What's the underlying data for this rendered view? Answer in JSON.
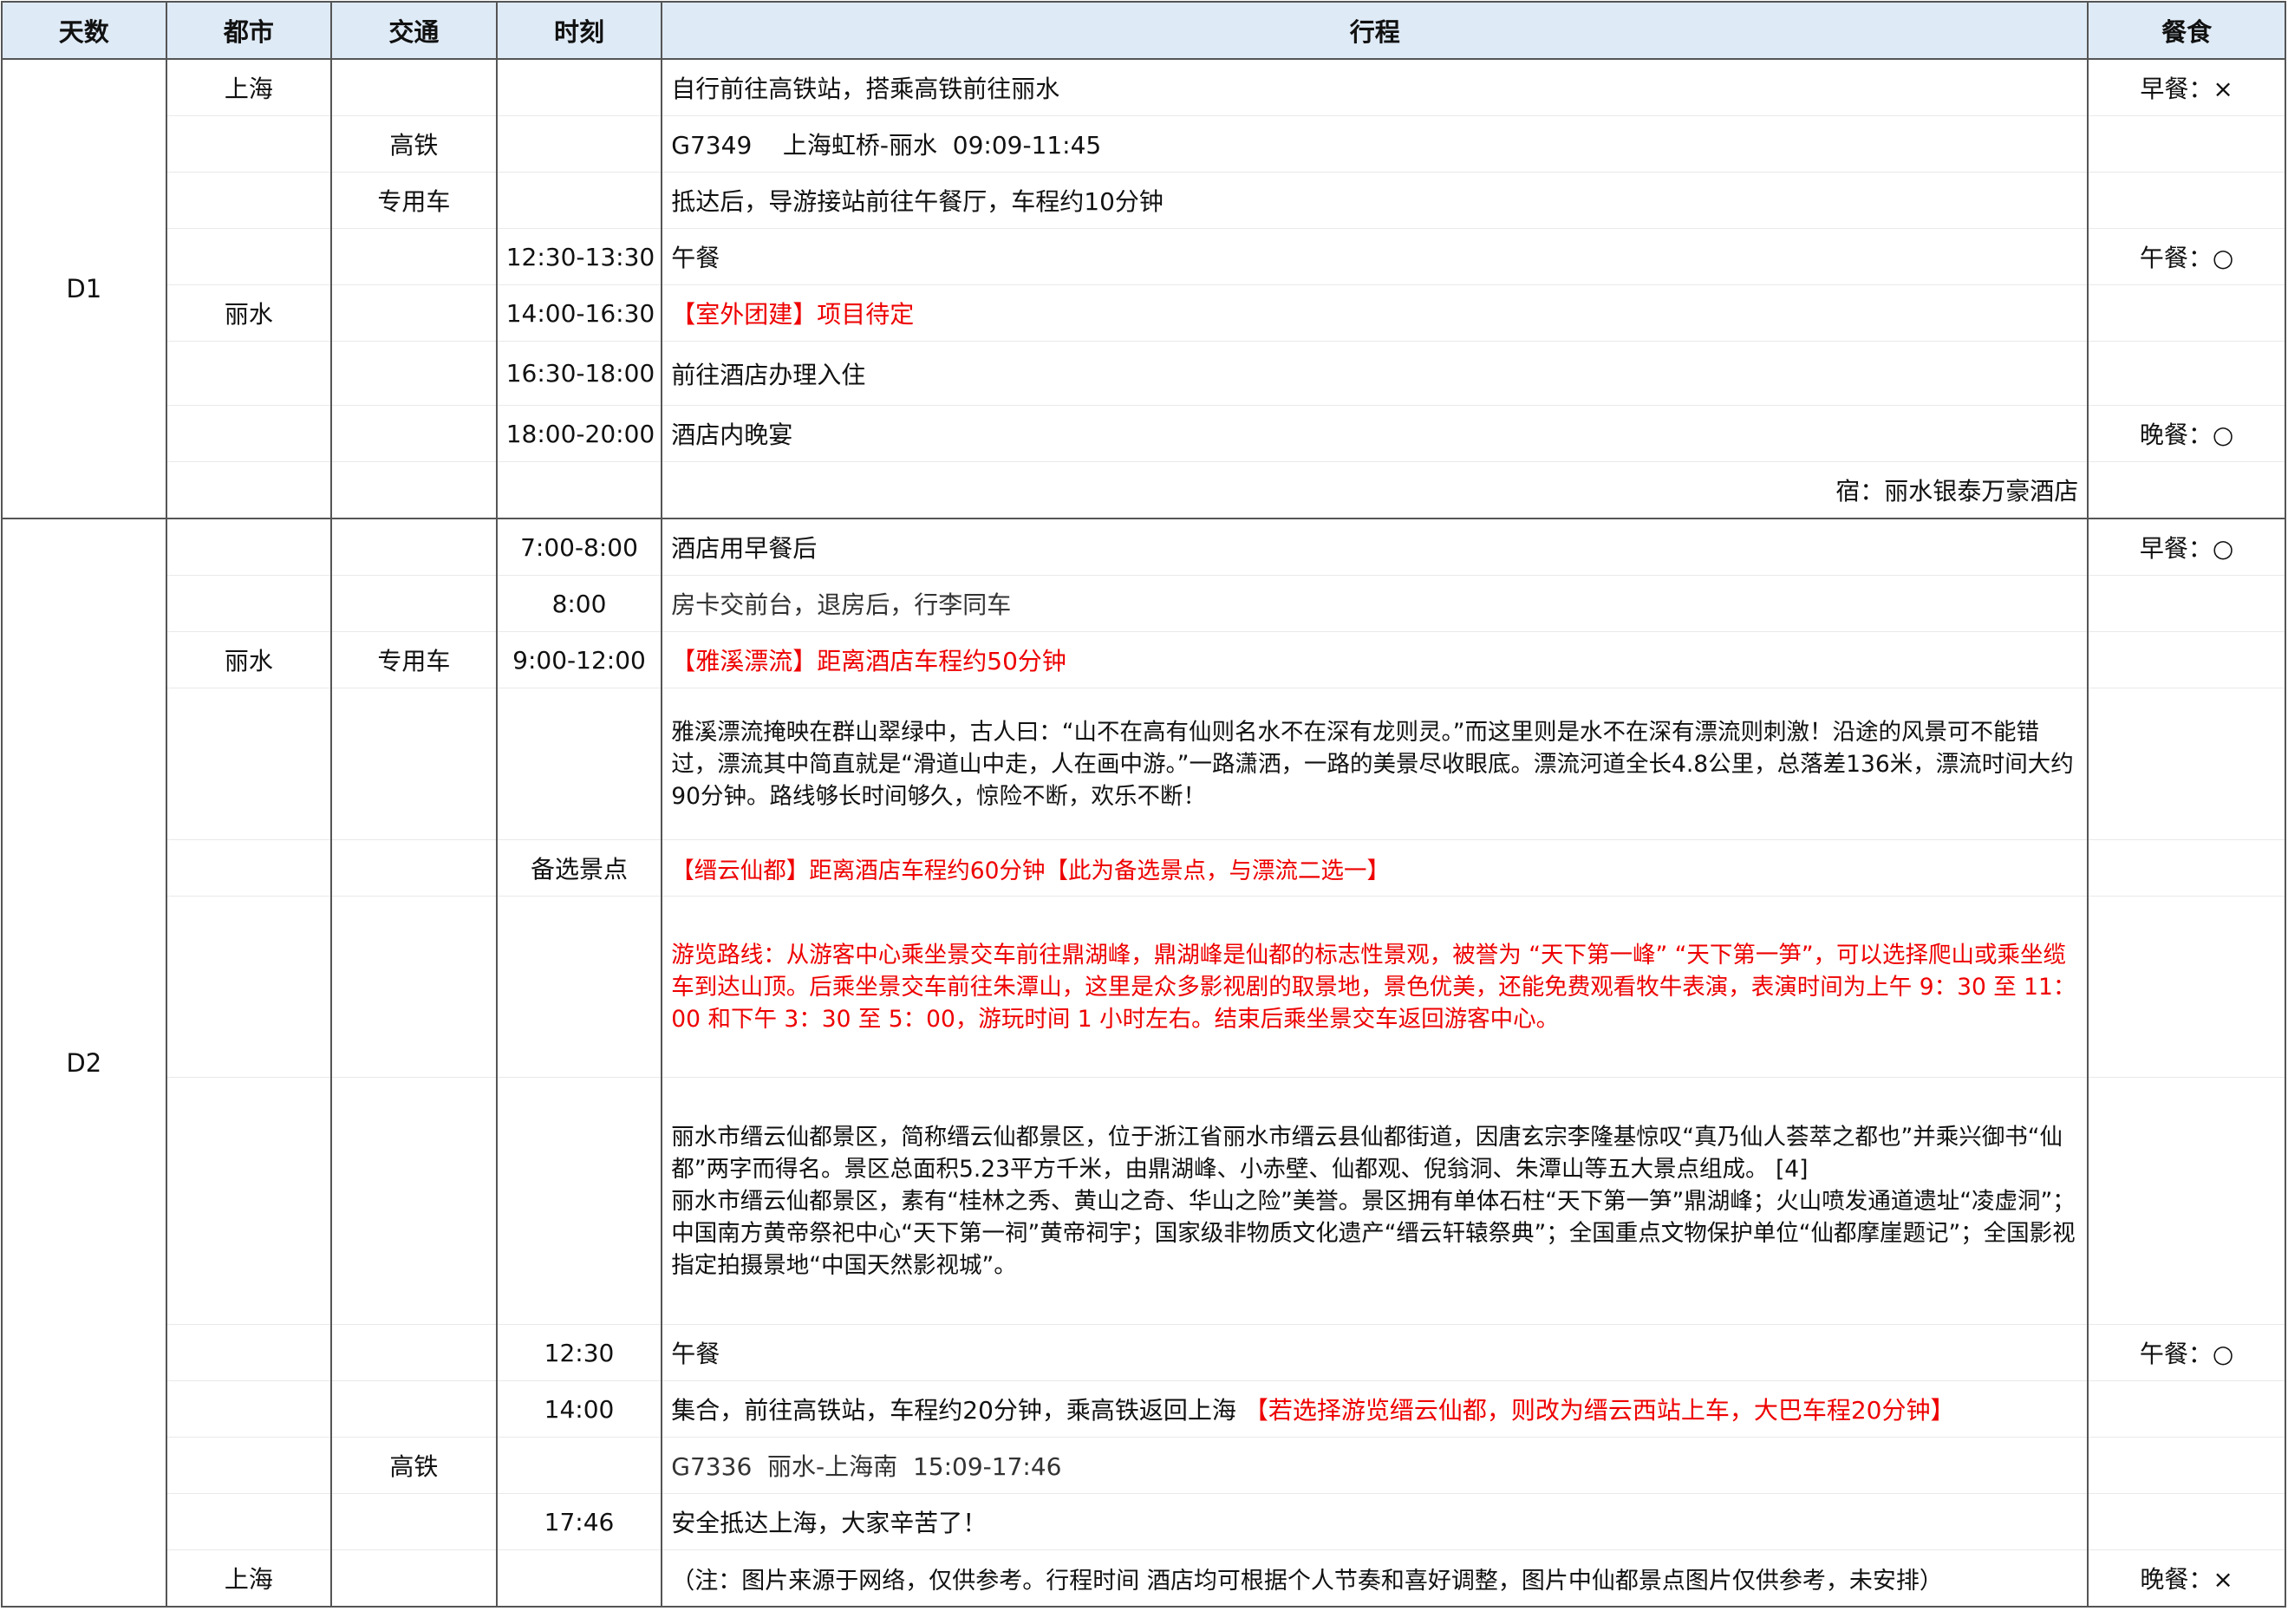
{
  "headers": {
    "day": "天数",
    "city": "都市",
    "transport": "交通",
    "time": "时刻",
    "itinerary": "行程",
    "meal": "餐食"
  },
  "d1": {
    "day": "D1",
    "rows": [
      {
        "city": "上海",
        "transport": "",
        "time": "",
        "text": "自行前往高铁站，搭乘高铁前往丽水",
        "meal": "早餐：×"
      },
      {
        "city": "",
        "transport": "高铁",
        "time": "",
        "text": "G7349    上海虹桥-丽水  09:09-11:45",
        "meal": ""
      },
      {
        "city": "",
        "transport": "专用车",
        "time": "",
        "text": "抵达后，导游接站前往午餐厅，车程约10分钟",
        "meal": ""
      },
      {
        "city": "",
        "transport": "",
        "time": "12:30-13:30",
        "text": "午餐",
        "meal": "午餐：○"
      },
      {
        "city": "丽水",
        "transport": "",
        "time": "14:00-16:30",
        "text": "【室外团建】项目待定",
        "meal": ""
      },
      {
        "city": "",
        "transport": "",
        "time": "16:30-18:00",
        "text": "前往酒店办理入住",
        "meal": ""
      },
      {
        "city": "",
        "transport": "",
        "time": "18:00-20:00",
        "text": "酒店内晚宴",
        "meal": "晚餐：○"
      },
      {
        "city": "",
        "transport": "",
        "time": "",
        "text": "宿：丽水银泰万豪酒店",
        "meal": ""
      }
    ]
  },
  "d2": {
    "day": "D2",
    "rows": [
      {
        "city": "",
        "transport": "",
        "time": "7:00-8:00",
        "text": "酒店用早餐后",
        "meal": "早餐：○"
      },
      {
        "city": "",
        "transport": "",
        "time": "8:00",
        "text": "房卡交前台，退房后，行李同车",
        "meal": ""
      },
      {
        "city": "丽水",
        "transport": "专用车",
        "time": "9:00-12:00",
        "text": "【雅溪漂流】距离酒店车程约50分钟",
        "meal": ""
      },
      {
        "city": "",
        "transport": "",
        "time": "",
        "text": "雅溪漂流掩映在群山翠绿中，古人曰：“山不在高有仙则名水不在深有龙则灵。”而这里则是水不在深有漂流则刺激！沿途的风景可不能错过，漂流其中简直就是“滑道山中走，人在画中游。”一路潇洒，一路的美景尽收眼底。漂流河道全长4.8公里，总落差136米，漂流时间大约90分钟。路线够长时间够久，惊险不断，欢乐不断！",
        "meal": ""
      },
      {
        "city": "",
        "transport": "",
        "time": "备选景点",
        "text": "【缙云仙都】距离酒店车程约60分钟【此为备选景点，与漂流二选一】",
        "meal": ""
      },
      {
        "city": "",
        "transport": "",
        "time": "",
        "text": "游览路线：从游客中心乘坐景交车前往鼎湖峰，鼎湖峰是仙都的标志性景观，被誉为 “天下第一峰” “天下第一笋”，可以选择爬山或乘坐缆车到达山顶。后乘坐景交车前往朱潭山，这里是众多影视剧的取景地，景色优美，还能免费观看牧牛表演，表演时间为上午 9：30 至 11：00 和下午 3：30 至 5：00，游玩时间 1 小时左右。结束后乘坐景交车返回游客中心。",
        "meal": ""
      },
      {
        "city": "",
        "transport": "",
        "time": "",
        "text1": "丽水市缙云仙都景区，简称缙云仙都景区，位于浙江省丽水市缙云县仙都街道，因唐玄宗李隆基惊叹“真乃仙人荟萃之都也”并乘兴御书“仙都”两字而得名。景区总面积5.23平方千米，由鼎湖峰、小赤壁、仙都观、倪翁洞、朱潭山等五大景点组成。 [4]",
        "text2": "丽水市缙云仙都景区，素有“桂林之秀、黄山之奇、华山之险”美誉。景区拥有单体石柱“天下第一笋”鼎湖峰；火山喷发通道遗址“凌虚洞”；中国南方黄帝祭祀中心“天下第一祠”黄帝祠宇；国家级非物质文化遗产“缙云轩辕祭典”；全国重点文物保护单位“仙都摩崖题记”；全国影视指定拍摄景地“中国天然影视城”。",
        "meal": ""
      },
      {
        "city": "",
        "transport": "",
        "time": "12:30",
        "text": "午餐",
        "meal": "午餐：○"
      },
      {
        "city": "",
        "transport": "",
        "time": "14:00",
        "text": "集合，前往高铁站，车程约20分钟，乘高铁返回上海 ",
        "text_red": "【若选择游览缙云仙都，则改为缙云西站上车，大巴车程20分钟】",
        "meal": ""
      },
      {
        "city": "",
        "transport": "高铁",
        "time": "",
        "text": "G7336  丽水-上海南  15:09-17:46",
        "meal": ""
      },
      {
        "city": "",
        "transport": "",
        "time": "17:46",
        "text": "安全抵达上海，大家辛苦了！",
        "meal": ""
      },
      {
        "city": "上海",
        "transport": "",
        "time": "",
        "text": "（注：图片来源于网络，仅供参考。行程时间 酒店均可根据个人节奏和喜好调整，图片中仙都景点图片仅供参考，未安排）",
        "meal": "晚餐：×"
      }
    ]
  },
  "colors": {
    "header_bg": "#deeaf6",
    "highlight_text": "#ee0000",
    "border": "#555555"
  }
}
